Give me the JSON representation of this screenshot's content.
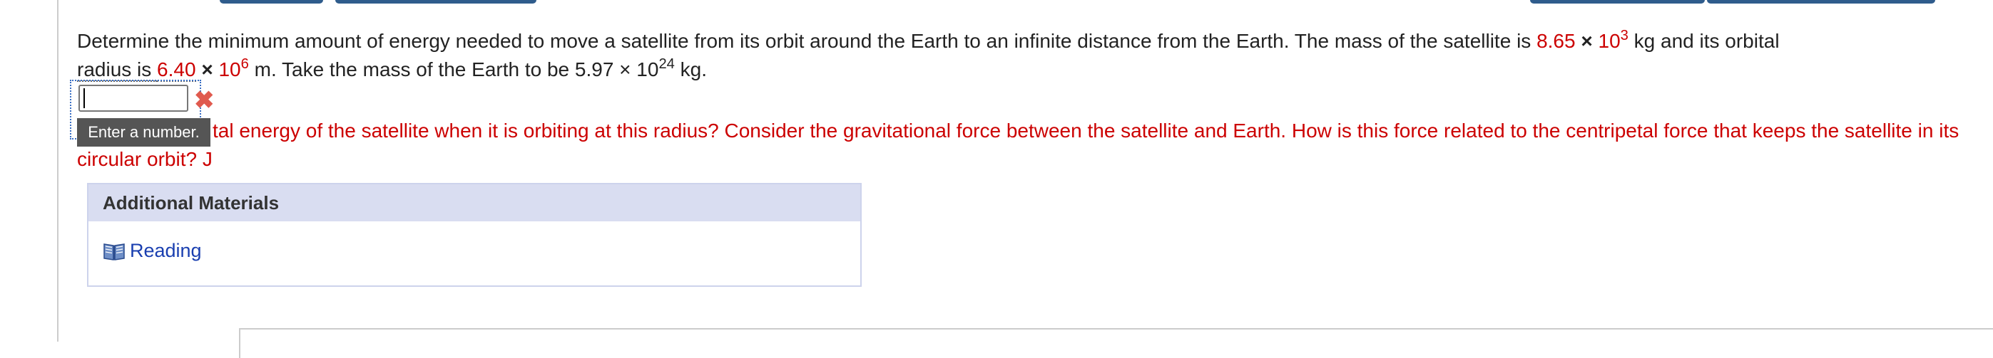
{
  "question": {
    "p1": "Determine the minimum amount of energy needed to move a satellite from its orbit around the Earth to an infinite distance from the Earth. The mass of the satellite is ",
    "mass_mantissa": "8.65",
    "times": "×",
    "base": "10",
    "mass_exp": "3",
    "p2": " kg and its orbital ",
    "radius_prefix": "radius is ",
    "radius_mantissa": "6.40",
    "radius_exp": "6",
    "p3": " m. Take the mass of the Earth to be 5.97 × 10",
    "earth_exp": "24",
    "p4": " kg."
  },
  "answer": {
    "value": "",
    "status": "incorrect",
    "tooltip": "Enter a number."
  },
  "hint": {
    "visible": "tal energy of the satellite when it is orbiting at this radius? Consider the gravitational force between the satellite and Earth. How is this force related to the centripetal force that keeps the satellite in its circular orbit? J"
  },
  "additional_materials": {
    "title": "Additional Materials",
    "items": [
      {
        "label": "Reading",
        "icon": "book-icon"
      }
    ]
  },
  "colors": {
    "highlight": "#cc0000",
    "link": "#1a3fb0",
    "panel_header": "#d9ddf1",
    "tooltip_bg": "#555555",
    "incorrect_mark": "#e05a4e"
  }
}
